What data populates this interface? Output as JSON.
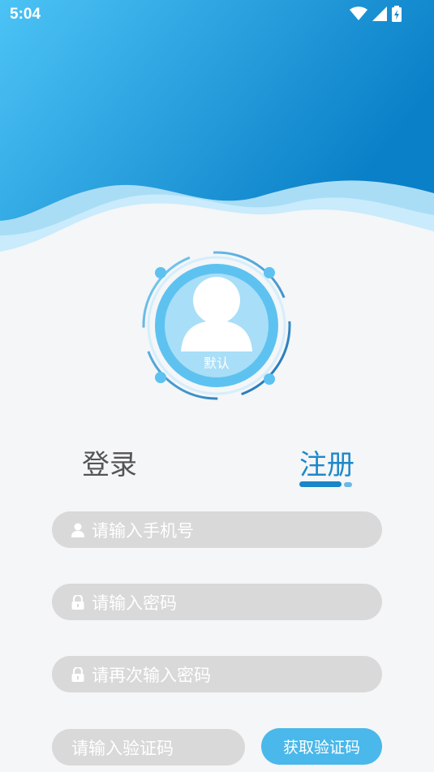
{
  "status_bar": {
    "time": "5:04"
  },
  "avatar": {
    "caption": "默认"
  },
  "tabs": {
    "login": "登录",
    "register": "注册",
    "active": "register"
  },
  "form": {
    "phone_placeholder": "请输入手机号",
    "password_placeholder": "请输入密码",
    "confirm_password_placeholder": "请再次输入密码",
    "code_placeholder": "请输入验证码",
    "get_code_label": "获取验证码"
  },
  "colors": {
    "accent": "#1e88c9",
    "button": "#4ab8ea",
    "field_bg": "#d9d9d9",
    "background": "#f4f6f8"
  },
  "icons": [
    "wifi-icon",
    "signal-icon",
    "battery-charging-icon",
    "user-icon",
    "lock-icon"
  ]
}
